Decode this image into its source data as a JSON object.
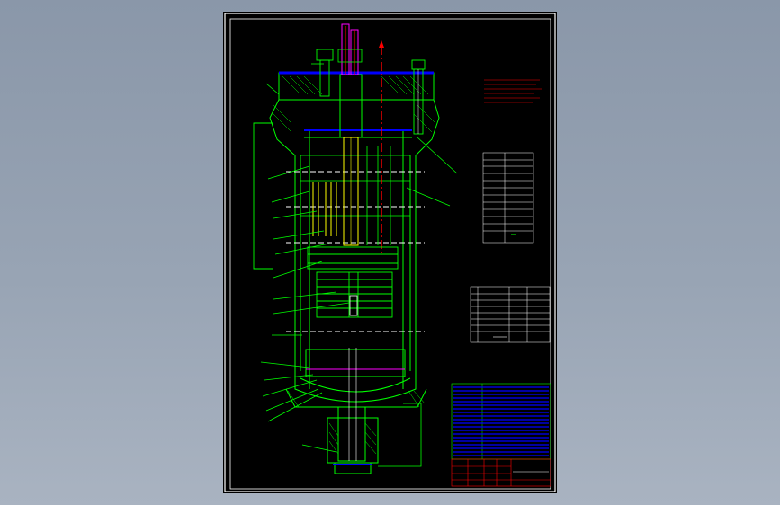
{
  "viewer": {
    "background_top": "#8a97a9",
    "background_bottom": "#a9b3c1",
    "sheet_background": "#000000"
  },
  "drawing": {
    "frame_color": "#ffffff",
    "outline_color": "#00ff00",
    "shaft_color": "#ffff00",
    "centerline_color": "#ff0000",
    "flange_color": "#0000ff",
    "accent_color": "#ff00ff",
    "bom_color": "#0000ff",
    "text": []
  }
}
